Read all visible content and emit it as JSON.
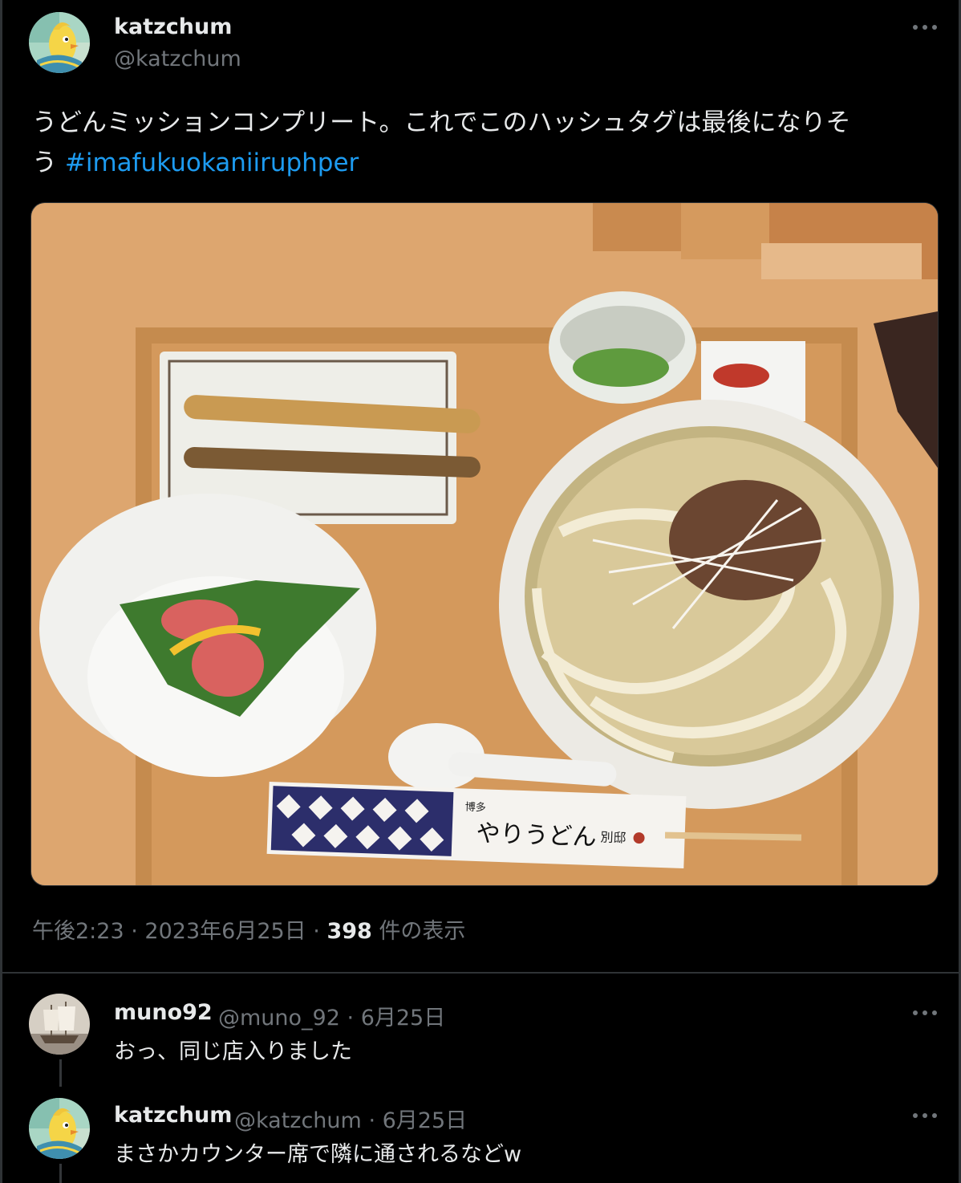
{
  "tweet": {
    "author": {
      "display_name": "katzchum",
      "handle": "@katzchum"
    },
    "text": "うどんミッションコンプリート。これでこのハッシュタグは最後になりそう",
    "text_line1": "うどんミッションコンプリート。これでこのハッシュタグは最後になりそ",
    "text_line2": "う",
    "hashtag": "#imafukuokaniiruphper",
    "time": "午後2:23",
    "date": "2023年6月25日",
    "views_count": "398",
    "views_label": "件の表示",
    "separator": "·"
  },
  "replies": [
    {
      "display_name": "muno92",
      "handle": "@muno_92",
      "date": "6月25日",
      "text": "おっ、同じ店入りました"
    },
    {
      "display_name": "katzchum",
      "handle": "@katzchum",
      "date": "6月25日",
      "text": "まさかカウンター席で隣に通されるなどw"
    }
  ],
  "photo": {
    "chopstick_wrapper_text": "やりうどん",
    "chopstick_wrapper_small": "博多",
    "chopstick_wrapper_suffix": "別邸"
  },
  "colors": {
    "background": "#000000",
    "text_primary": "#e7e9ea",
    "text_secondary": "#71767b",
    "link": "#1d9bf0",
    "divider": "#2f3336"
  },
  "icons": [
    "more-icon",
    "avatar-bird-icon",
    "avatar-ship-icon"
  ]
}
